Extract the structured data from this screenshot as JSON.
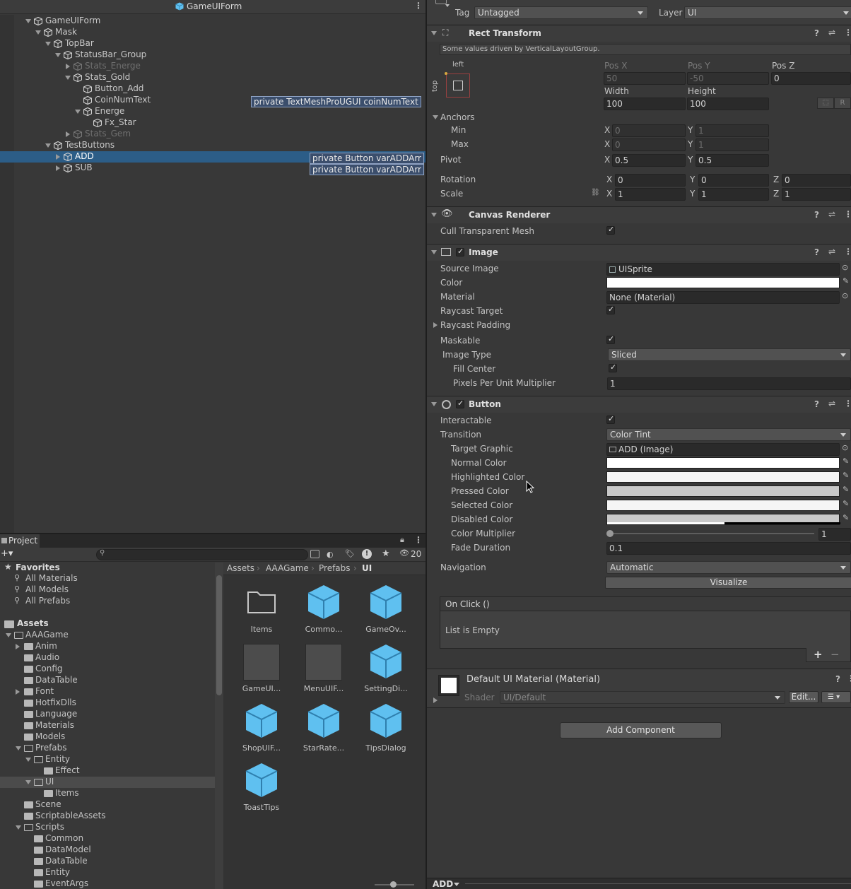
{
  "hierarchy": {
    "title": "GameUIForm",
    "items": [
      {
        "label": "GameUIForm",
        "depth": 0,
        "expanded": true,
        "dim": false
      },
      {
        "label": "Mask",
        "depth": 1,
        "expanded": true,
        "dim": false
      },
      {
        "label": "TopBar",
        "depth": 2,
        "expanded": true,
        "dim": false
      },
      {
        "label": "StatusBar_Group",
        "depth": 3,
        "expanded": true,
        "dim": false
      },
      {
        "label": "Stats_Energe",
        "depth": 4,
        "expanded": false,
        "dim": true
      },
      {
        "label": "Stats_Gold",
        "depth": 4,
        "expanded": true,
        "dim": false
      },
      {
        "label": "Button_Add",
        "depth": 5,
        "expanded": null,
        "dim": false
      },
      {
        "label": "CoinNumText",
        "depth": 5,
        "expanded": null,
        "dim": false
      },
      {
        "label": "Energe",
        "depth": 5,
        "expanded": true,
        "dim": false
      },
      {
        "label": "Fx_Star",
        "depth": 6,
        "expanded": null,
        "dim": false
      },
      {
        "label": "Stats_Gem",
        "depth": 4,
        "expanded": false,
        "dim": true
      },
      {
        "label": "TestButtons",
        "depth": 2,
        "expanded": true,
        "dim": false
      },
      {
        "label": "ADD",
        "depth": 3,
        "expanded": false,
        "dim": false,
        "selected": true
      },
      {
        "label": "SUB",
        "depth": 3,
        "expanded": false,
        "dim": false
      }
    ],
    "tooltips": {
      "coin": "private TextMeshProUGUI coinNumText",
      "add": "private Button varADDArr",
      "sub": "private Button varADDArr"
    }
  },
  "project": {
    "tab": "Project",
    "search_placeholder": "",
    "hidden_count": "20",
    "favorites_label": "Favorites",
    "favorites": [
      "All Materials",
      "All Models",
      "All Prefabs"
    ],
    "assets_label": "Assets",
    "tree": [
      {
        "label": "AAAGame",
        "depth": 1,
        "arrow": "down"
      },
      {
        "label": "Anim",
        "depth": 2,
        "arrow": "right"
      },
      {
        "label": "Audio",
        "depth": 2,
        "arrow": ""
      },
      {
        "label": "Config",
        "depth": 2,
        "arrow": ""
      },
      {
        "label": "DataTable",
        "depth": 2,
        "arrow": ""
      },
      {
        "label": "Font",
        "depth": 2,
        "arrow": "right"
      },
      {
        "label": "HotfixDlls",
        "depth": 2,
        "arrow": ""
      },
      {
        "label": "Language",
        "depth": 2,
        "arrow": ""
      },
      {
        "label": "Materials",
        "depth": 2,
        "arrow": ""
      },
      {
        "label": "Models",
        "depth": 2,
        "arrow": ""
      },
      {
        "label": "Prefabs",
        "depth": 2,
        "arrow": "down"
      },
      {
        "label": "Entity",
        "depth": 3,
        "arrow": "down"
      },
      {
        "label": "Effect",
        "depth": 4,
        "arrow": ""
      },
      {
        "label": "UI",
        "depth": 3,
        "arrow": "down",
        "selected": true
      },
      {
        "label": "Items",
        "depth": 4,
        "arrow": ""
      },
      {
        "label": "Scene",
        "depth": 2,
        "arrow": ""
      },
      {
        "label": "ScriptableAssets",
        "depth": 2,
        "arrow": ""
      },
      {
        "label": "Scripts",
        "depth": 2,
        "arrow": "down"
      },
      {
        "label": "Common",
        "depth": 3,
        "arrow": ""
      },
      {
        "label": "DataModel",
        "depth": 3,
        "arrow": ""
      },
      {
        "label": "DataTable",
        "depth": 3,
        "arrow": ""
      },
      {
        "label": "Entity",
        "depth": 3,
        "arrow": ""
      },
      {
        "label": "EventArgs",
        "depth": 3,
        "arrow": ""
      }
    ],
    "breadcrumb": [
      "Assets",
      "AAAGame",
      "Prefabs",
      "UI"
    ],
    "grid": [
      {
        "label": "Items",
        "kind": "folder"
      },
      {
        "label": "Commo...",
        "kind": "cube"
      },
      {
        "label": "GameOv...",
        "kind": "cube"
      },
      {
        "label": "GameUI...",
        "kind": "box"
      },
      {
        "label": "MenuUIF...",
        "kind": "box"
      },
      {
        "label": "SettingDi...",
        "kind": "cube"
      },
      {
        "label": "ShopUIF...",
        "kind": "cube"
      },
      {
        "label": "StarRate...",
        "kind": "cube"
      },
      {
        "label": "TipsDialog",
        "kind": "cube"
      },
      {
        "label": "ToastTips",
        "kind": "cube"
      }
    ]
  },
  "inspector": {
    "tag_label": "Tag",
    "tag_value": "Untagged",
    "layer_label": "Layer",
    "layer_value": "UI",
    "rect": {
      "title": "Rect Transform",
      "note": "Some values driven by VerticalLayoutGroup.",
      "anchor_h": "left",
      "anchor_v": "top",
      "posx_label": "Pos X",
      "posy_label": "Pos Y",
      "posz_label": "Pos Z",
      "posx": "50",
      "posy": "-50",
      "posz": "0",
      "width_label": "Width",
      "height_label": "Height",
      "width": "100",
      "height": "100",
      "r_button": "R",
      "anchors_label": "Anchors",
      "min_label": "Min",
      "max_label": "Max",
      "min_x": "0",
      "min_y": "1",
      "max_x": "0",
      "max_y": "1",
      "pivot_label": "Pivot",
      "pivot_x": "0.5",
      "pivot_y": "0.5",
      "rotation_label": "Rotation",
      "rot_x": "0",
      "rot_y": "0",
      "rot_z": "0",
      "scale_label": "Scale",
      "scale_x": "1",
      "scale_y": "1",
      "scale_z": "1",
      "x": "X",
      "y": "Y",
      "z": "Z"
    },
    "canvas_renderer": {
      "title": "Canvas Renderer",
      "cull_label": "Cull Transparent Mesh"
    },
    "image": {
      "title": "Image",
      "source_label": "Source Image",
      "source_value": "UISprite",
      "color_label": "Color",
      "material_label": "Material",
      "material_value": "None (Material)",
      "raycast_label": "Raycast Target",
      "padding_label": "Raycast Padding",
      "maskable_label": "Maskable",
      "type_label": "Image Type",
      "type_value": "Sliced",
      "fill_label": "Fill Center",
      "ppu_label": "Pixels Per Unit Multiplier",
      "ppu_value": "1"
    },
    "button": {
      "title": "Button",
      "interactable_label": "Interactable",
      "transition_label": "Transition",
      "transition_value": "Color Tint",
      "target_label": "Target Graphic",
      "target_value": "ADD (Image)",
      "normal_label": "Normal Color",
      "highlighted_label": "Highlighted Color",
      "pressed_label": "Pressed Color",
      "selected_label": "Selected Color",
      "disabled_label": "Disabled Color",
      "multiplier_label": "Color Multiplier",
      "multiplier_value": "1",
      "fade_label": "Fade Duration",
      "fade_value": "0.1",
      "navigation_label": "Navigation",
      "navigation_value": "Automatic",
      "visualize_label": "Visualize",
      "onclick_label": "On Click ()",
      "list_empty": "List is Empty",
      "colors": {
        "normal": "#ffffff",
        "highlighted": "#f5f5f5",
        "pressed": "#c8c8c8",
        "selected": "#f5f5f5",
        "disabled": "#c8c8c8"
      }
    },
    "material": {
      "title": "Default UI Material (Material)",
      "shader_label": "Shader",
      "shader_value": "UI/Default",
      "edit_label": "Edit..."
    },
    "add_component": "Add Component",
    "footer_label": "ADD"
  },
  "colors": {
    "selection": "#2c5d87",
    "cube": "#5fc0f0"
  }
}
